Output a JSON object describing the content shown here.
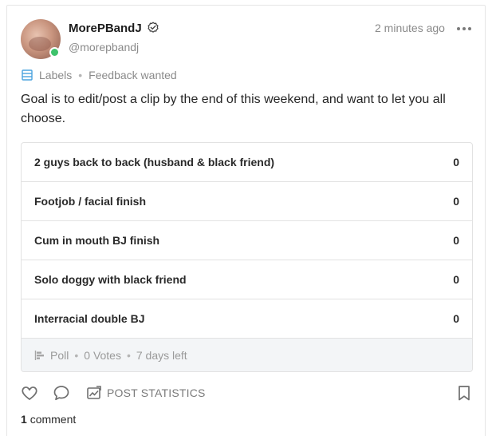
{
  "post": {
    "author": {
      "display_name": "MorePBandJ",
      "handle": "@morepbandj",
      "online": true,
      "verified": true
    },
    "timestamp": "2 minutes ago",
    "labels": {
      "label": "Labels",
      "tag": "Feedback wanted"
    },
    "text": "Goal is to edit/post a clip by the end of this weekend, and want to let you all choose.",
    "poll": {
      "options": [
        {
          "label": "2 guys back to back (husband & black friend)",
          "count": "0"
        },
        {
          "label": "Footjob / facial finish",
          "count": "0"
        },
        {
          "label": "Cum in mouth BJ finish",
          "count": "0"
        },
        {
          "label": "Solo doggy with black friend",
          "count": "0"
        },
        {
          "label": "Interracial double BJ",
          "count": "0"
        }
      ],
      "footer": {
        "type": "Poll",
        "votes": "0 Votes",
        "remaining": "7 days left"
      }
    },
    "actions": {
      "like_icon": "heart-icon",
      "comment_icon": "comment-bubble-icon",
      "stats_icon": "chart-image-icon",
      "stats_label": "POST STATISTICS",
      "bookmark_icon": "bookmark-icon"
    },
    "comments": {
      "count": "1",
      "label": "comment"
    }
  },
  "colors": {
    "muted_text": "#8a8a8a",
    "online": "#3ec26b",
    "label_accent": "#4aa3df",
    "poll_footer_bg": "#f3f5f7"
  }
}
